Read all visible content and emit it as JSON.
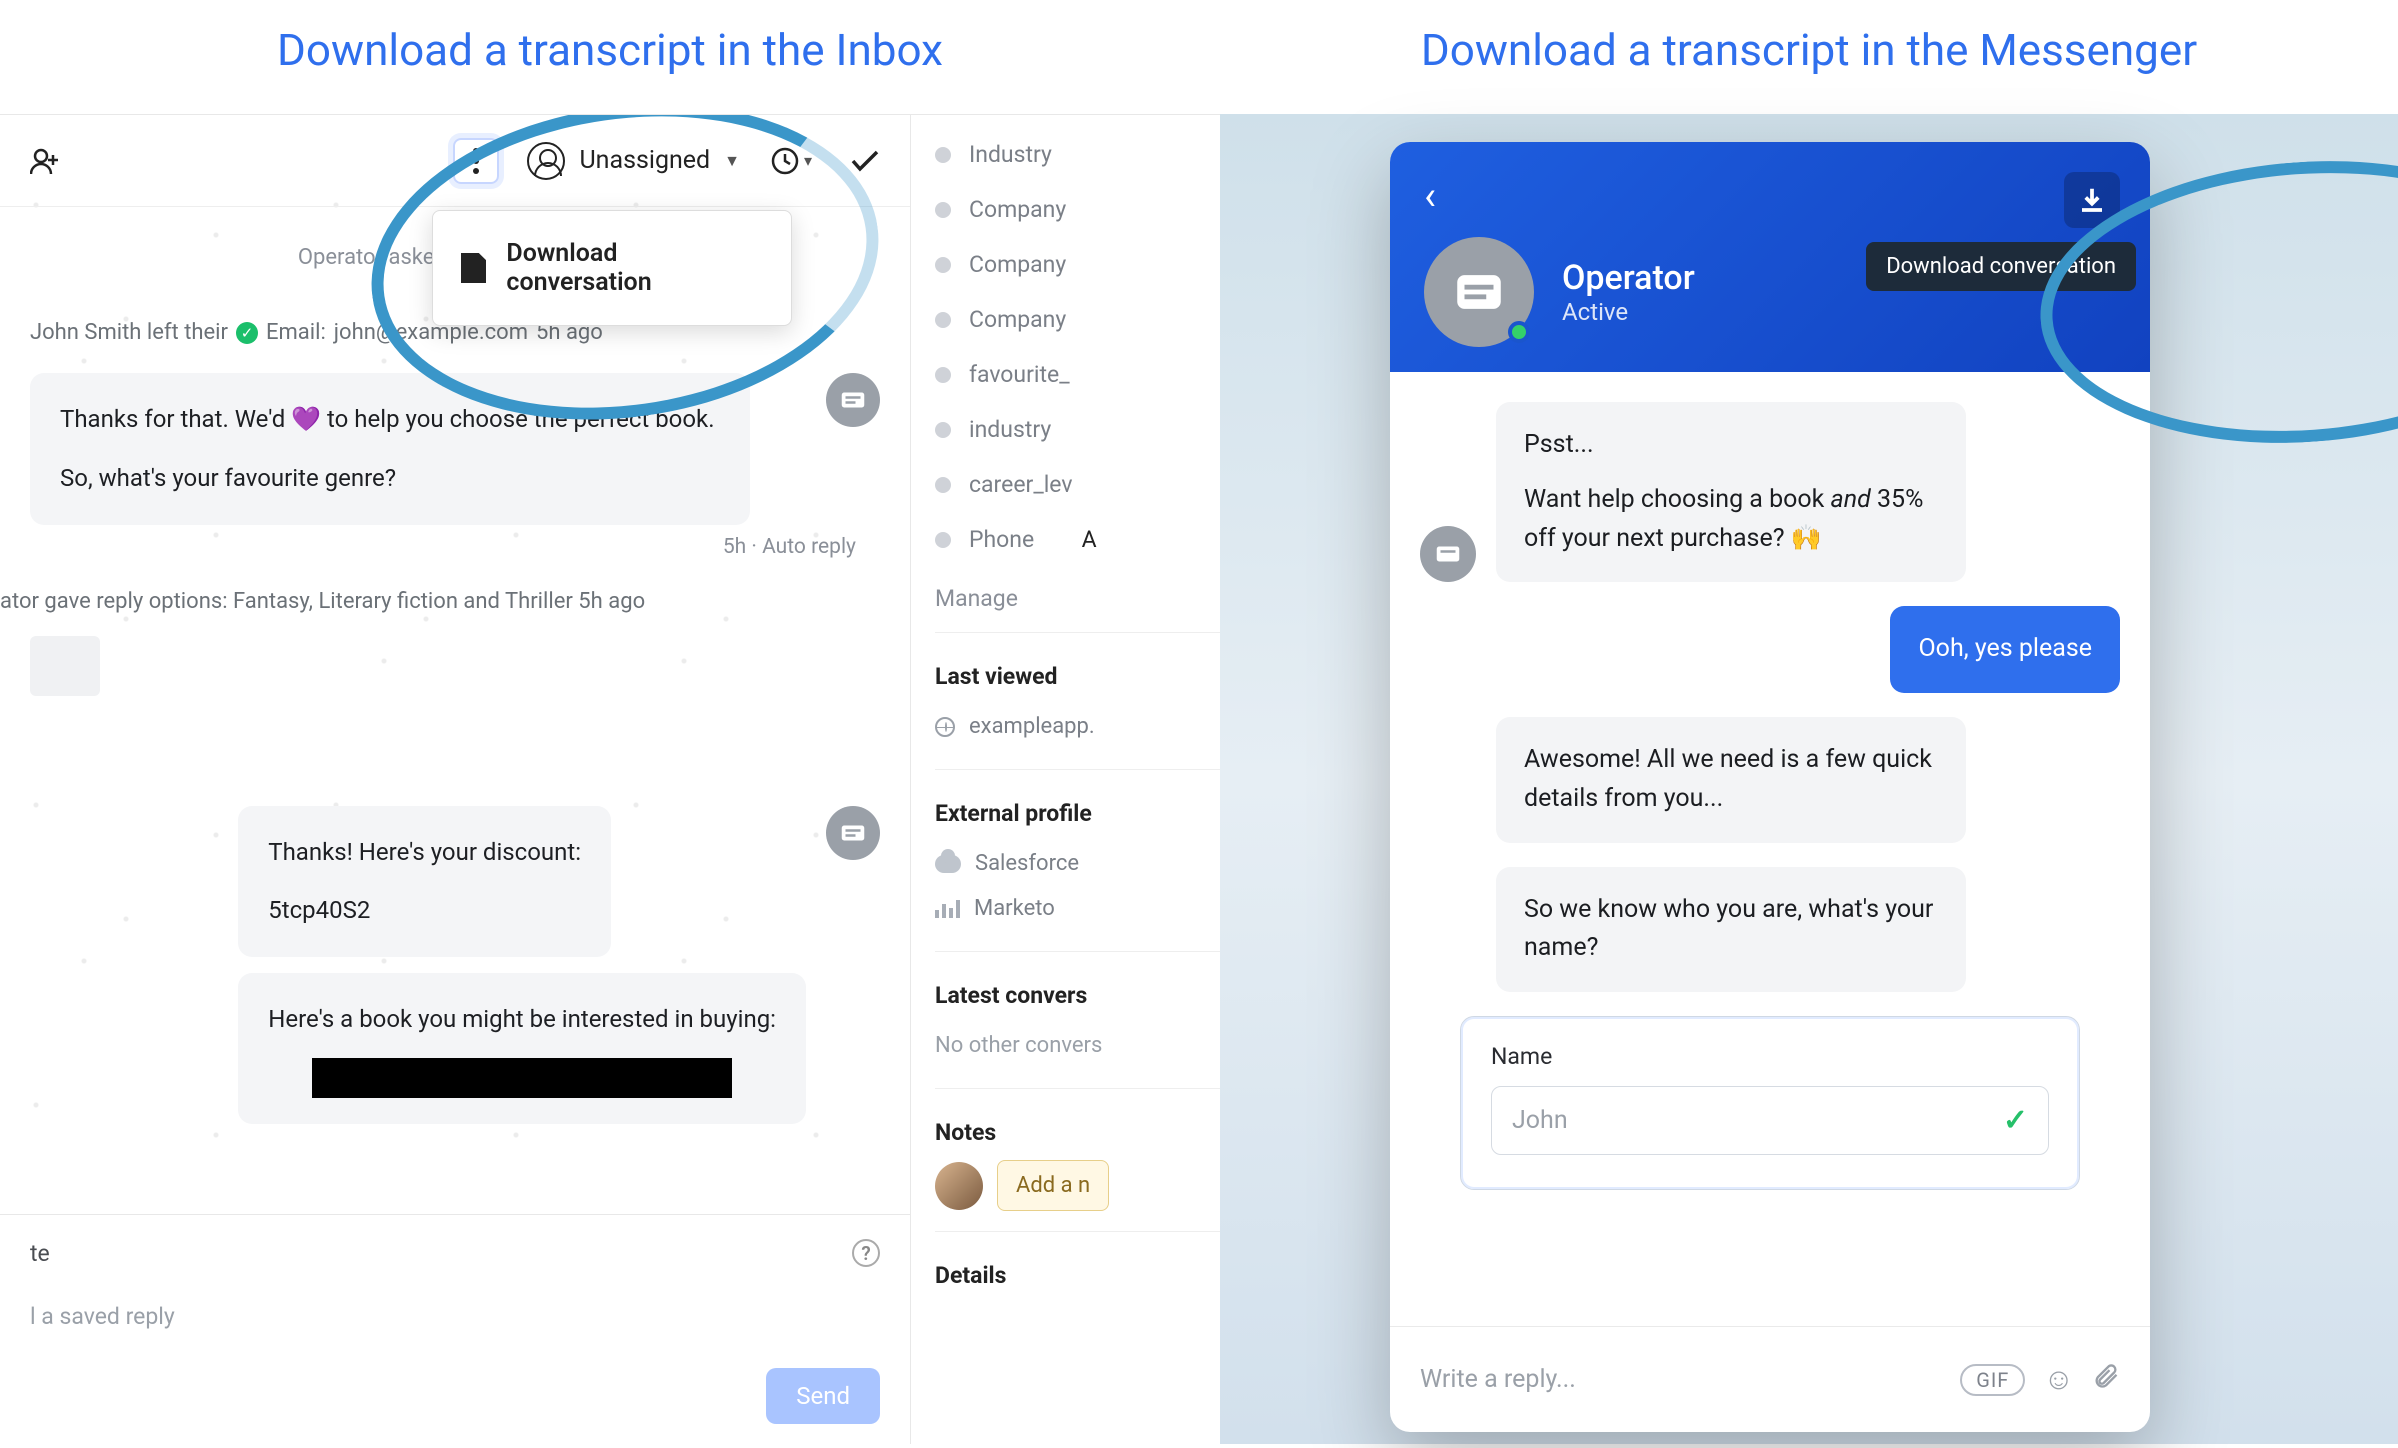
{
  "captions": {
    "left": "Download a transcript in the Inbox",
    "right": "Download a transcript in the Messenger"
  },
  "inbox": {
    "toolbar": {
      "assignee": "Unassigned"
    },
    "dropdown": {
      "download": "Download conversation"
    },
    "events": {
      "asked": "Operator asked for Email 5h ago",
      "left_prefix": "John Smith left their",
      "left_email_label": "Email:",
      "left_email_value": "john@example.com",
      "left_time": "5h ago",
      "reply_options": "ator gave reply options: Fantasy, Literary fiction and Thriller 5h ago"
    },
    "bubbles": {
      "b1_line1": "Thanks for that. We'd 💜  to help you choose the perfect book.",
      "b1_line2": "So, what's your favourite genre?",
      "b1_meta": "5h · Auto reply",
      "b2_line1": "Thanks! Here's your discount:",
      "b2_line2": "5tcp40S2",
      "b3_line1": "Here's a book you might be interested in buying:"
    },
    "composer": {
      "tab": "te",
      "hint": "l a saved reply",
      "send": "Send"
    },
    "side": {
      "fields": [
        "Industry",
        "Company",
        "Company",
        "Company",
        "favourite_",
        "industry",
        "career_lev"
      ],
      "phone_label": "Phone",
      "phone_value": "A",
      "manage": "Manage",
      "last_viewed_head": "Last viewed",
      "last_viewed_val": "exampleapp.",
      "ext_head": "External profile",
      "ext_sf": "Salesforce",
      "ext_mk": "Marketo",
      "latest_head": "Latest convers",
      "latest_empty": "No other convers",
      "notes_head": "Notes",
      "add_note": "Add a n",
      "details_head": "Details"
    }
  },
  "messenger": {
    "header": {
      "name": "Operator",
      "status": "Active",
      "tooltip": "Download conversation"
    },
    "bubbles": {
      "psst": "Psst...",
      "intro_a": "Want help choosing a book ",
      "intro_em": "and",
      "intro_b": " 35% off your next purchase? 🙌",
      "user_reply": "Ooh, yes please",
      "awesome": "Awesome! All we need is a few quick details from you...",
      "askname": "So we know who you are, what's your name?"
    },
    "card": {
      "label": "Name",
      "value": "John"
    },
    "composer": {
      "placeholder": "Write a reply...",
      "gif": "GIF"
    }
  }
}
